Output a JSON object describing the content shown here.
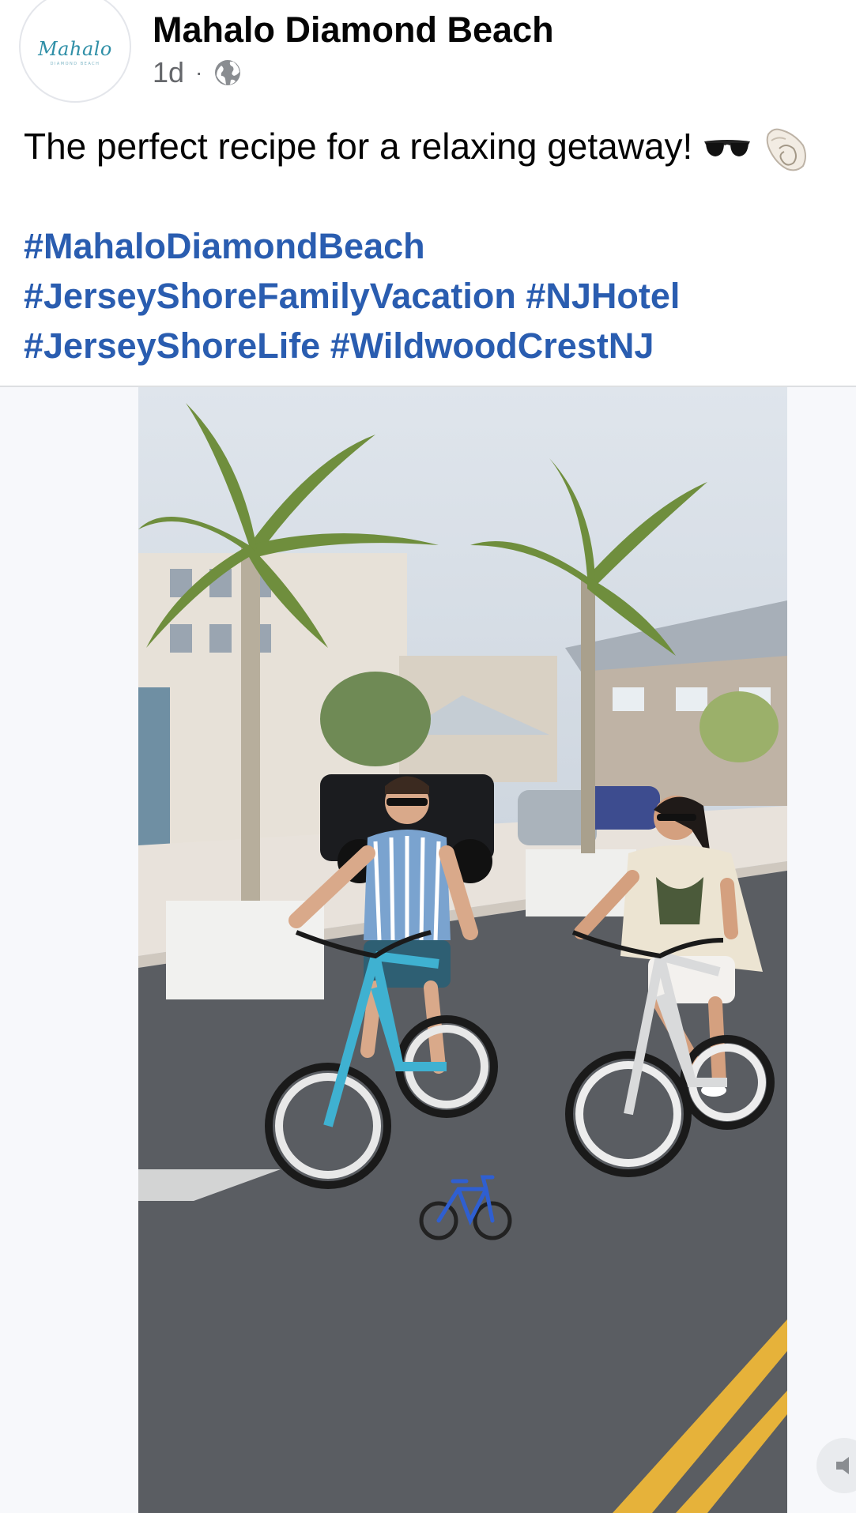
{
  "post": {
    "author": "Mahalo Diamond Beach",
    "time": "1d",
    "separator": "·",
    "privacy_icon": "globe-icon",
    "logo_text": "Mahalo",
    "logo_subtext": "DIAMOND BEACH",
    "caption": "The perfect recipe for a relaxing getaway!",
    "caption_emojis": [
      "sunglasses",
      "spiral-shell"
    ],
    "hashtags": [
      "#MahaloDiamondBeach",
      "#JerseyShoreFamilyVacation",
      "#NJHotel",
      "#JerseyShoreLife",
      "#WildwoodCrestNJ"
    ]
  },
  "video": {
    "description_icon": "bicycle-icon"
  },
  "colors": {
    "hashtag": "#2a5db0",
    "meta": "#65676b",
    "logo": "#2f8fa7"
  }
}
